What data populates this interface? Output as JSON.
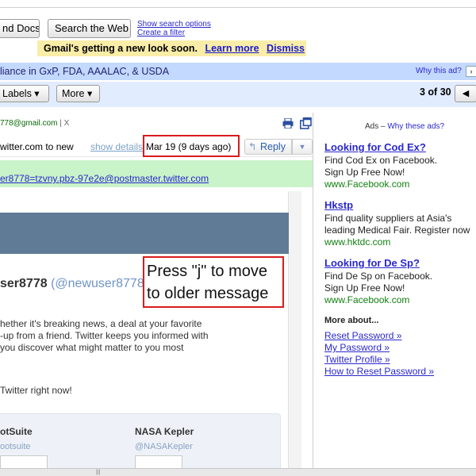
{
  "search": {
    "docs_label": "nd Docs",
    "web_label": "Search the Web",
    "show_options": "Show search options",
    "create_filter": "Create a filter"
  },
  "notice": {
    "text": "Gmail's getting a new look soon.",
    "learn_more": "Learn more",
    "dismiss": "Dismiss"
  },
  "sponsored": {
    "text": "liance in GxP, FDA, AAALAC, & USDA",
    "why": "Why this ad?",
    "arrow": "›"
  },
  "toolbar": {
    "labels": "Labels ▾",
    "more": "More ▾",
    "pager": "3 of 30",
    "prev_arrow": "◀"
  },
  "message": {
    "from_email": "778@gmail.com",
    "from_sep": "| X",
    "to_text": "witter.com to new",
    "show_details": "show details",
    "date": "Mar 19 (9 days ago)",
    "reply": "Reply",
    "reply_icon": "↰",
    "reply_more": "▼",
    "reply_to": "er8778=tzvny.pbz-97e2e@postmaster.twitter.com"
  },
  "email": {
    "user_name": "ser8778",
    "user_handle": "(@newuser8778)",
    "body_lines": [
      "hether it's breaking news, a deal at your favorite",
      "-up from a friend. Twitter keeps you informed with",
      "you discover what might matter to you most"
    ],
    "cta": "Twitter right now!",
    "accounts": [
      {
        "name": "otSuite",
        "handle": "ootsuite"
      },
      {
        "name": "NASA Kepler",
        "handle": "@NASAKepler"
      }
    ]
  },
  "callout": {
    "line1": "Press \"j\" to move",
    "line2": "to older message"
  },
  "ads": {
    "label": "Ads –",
    "why": "Why these ads?",
    "items": [
      {
        "title": "Looking for Cod Ex?",
        "line1": "Find Cod Ex on Facebook.",
        "line2": "Sign Up Free Now!",
        "url": "www.Facebook.com"
      },
      {
        "title": "Hkstp",
        "line1": "Find quality suppliers at Asia's",
        "line2": "leading Medical Fair. Register now",
        "url": "www.hktdc.com"
      },
      {
        "title": "Looking for De Sp?",
        "line1": "Find De Sp on Facebook.",
        "line2": "Sign Up Free Now!",
        "url": "www.Facebook.com"
      }
    ],
    "about_head": "More about...",
    "about_links": [
      "Reset Password »",
      "My Password »",
      "Twitter Profile »",
      "How to Reset Password »"
    ]
  },
  "colors": {
    "highlight_red": "#d81c1c",
    "link_blue": "#2a28cc",
    "ad_url_green": "#128012"
  },
  "icons": {
    "print": "print-icon",
    "new_window": "new-window-icon"
  }
}
